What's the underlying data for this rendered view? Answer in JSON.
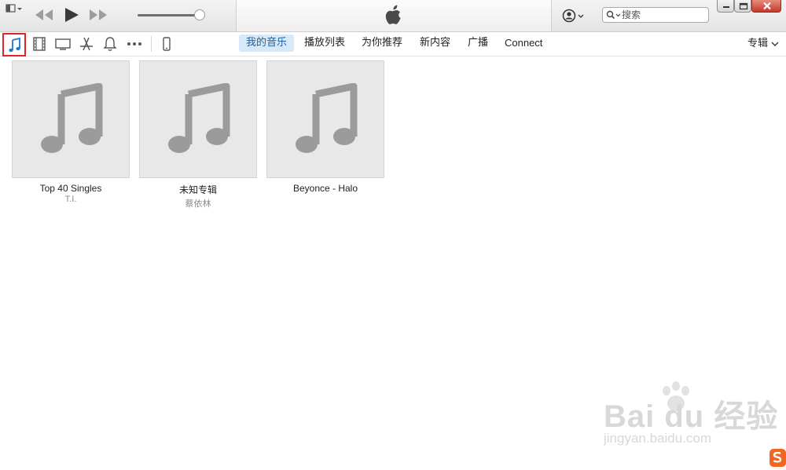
{
  "window": {
    "minimize_icon": "minimize-icon",
    "maximize_icon": "maximize-icon",
    "close_icon": "close-icon"
  },
  "player": {
    "sidebar_toggle_icon": "sidebar-toggle-icon",
    "rewind_icon": "rewind-icon",
    "play_icon": "play-icon",
    "fast_forward_icon": "fast-forward-icon",
    "volume_level": 0.93
  },
  "lcd": {
    "logo_icon": "apple-logo-icon"
  },
  "account": {
    "icon": "account-icon"
  },
  "search": {
    "placeholder": "搜索",
    "value": ""
  },
  "media_kinds": [
    {
      "name": "music",
      "icon": "music-note-icon",
      "selected": true
    },
    {
      "name": "movies",
      "icon": "film-icon"
    },
    {
      "name": "tv",
      "icon": "tv-icon"
    },
    {
      "name": "apps",
      "icon": "app-store-icon"
    },
    {
      "name": "tones",
      "icon": "bell-icon"
    },
    {
      "name": "more",
      "icon": "more-icon"
    },
    {
      "name": "device",
      "icon": "iphone-icon"
    }
  ],
  "nav": {
    "tabs": [
      {
        "label": "我的音乐",
        "active": true
      },
      {
        "label": "播放列表"
      },
      {
        "label": "为你推荐"
      },
      {
        "label": "新内容"
      },
      {
        "label": "广播"
      },
      {
        "label": "Connect"
      }
    ],
    "view_label": "专辑"
  },
  "albums": [
    {
      "title": "Top 40 Singles",
      "artist": "T.I.",
      "art_icon": "music-note-icon"
    },
    {
      "title": "未知专辑",
      "artist": "蔡依林",
      "art_icon": "music-note-icon"
    },
    {
      "title": "Beyonce - Halo",
      "artist": "",
      "art_icon": "music-note-icon"
    }
  ],
  "colors": {
    "selection_border": "#e2232d",
    "active_tab_bg": "#d7e9f9",
    "active_tab_text": "#1f5e9c",
    "album_placeholder": "#e8e8e8",
    "note_gray": "#9b9b9b"
  },
  "watermark": {
    "logo_text": "Bai du 经验",
    "url": "jingyan.baidu.com",
    "corner_icon": "sogou-icon"
  }
}
